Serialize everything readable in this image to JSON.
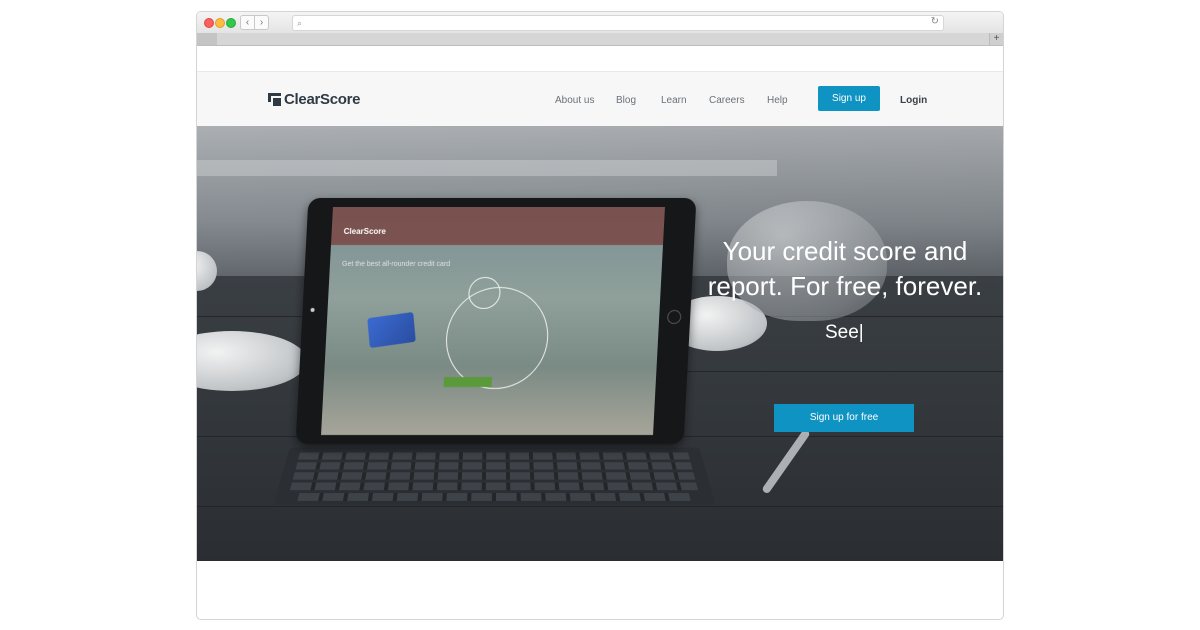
{
  "browser": {
    "back_icon": "‹",
    "forward_icon": "›",
    "search_icon": "⌕",
    "reload_icon": "↻",
    "new_tab_icon": "+"
  },
  "site": {
    "logo_text": "ClearScore",
    "nav": [
      "About us",
      "Blog",
      "Learn",
      "Careers",
      "Help"
    ],
    "signup_label": "Sign up",
    "login_label": "Login"
  },
  "hero": {
    "title_line1": "Your credit score and",
    "title_line2": "report. For free, forever.",
    "subtitle": "See|",
    "cta_label": "Sign up for free"
  },
  "ipad_screen": {
    "logo_text": "ClearScore",
    "headline": "Get the best all-rounder credit card"
  },
  "colors": {
    "accent": "#0e93c2",
    "logo": "#2f3a44"
  }
}
